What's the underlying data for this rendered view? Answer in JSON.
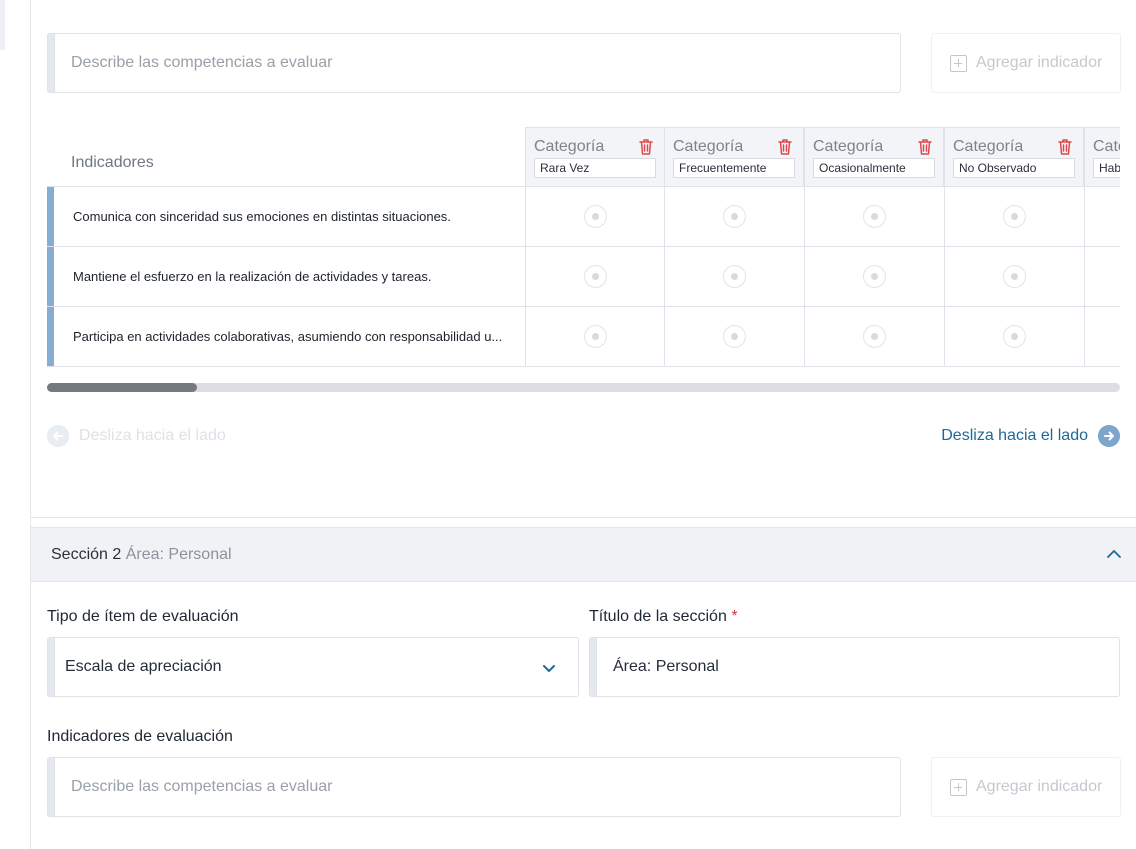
{
  "section1": {
    "indicator_input": {
      "placeholder": "Describe las competencias a evaluar"
    },
    "add_indicator_label": "Agregar indicador",
    "table": {
      "indicators_header": "Indicadores",
      "category_title": "Categoría",
      "categories": [
        "Rara Vez",
        "Frecuentemente",
        "Ocasionalmente",
        "No Observado",
        "Hab"
      ],
      "partial_category_title": "Cate",
      "rows": [
        "Comunica con sinceridad sus emociones en distintas situaciones.",
        "Mantiene el esfuerzo en la realización de actividades y tareas.",
        "Participa en actividades colaborativas, asumiendo con responsabilidad u..."
      ]
    },
    "scroll_progress_percent": 14,
    "swipe_left_label": "Desliza hacia el lado",
    "swipe_right_label": "Desliza hacia el lado"
  },
  "section2": {
    "header_title": "Sección 2",
    "header_subtitle": "Área: Personal",
    "item_type_label": "Tipo de ítem de evaluación",
    "item_type_value": "Escala de apreciación",
    "section_title_label": "Título de la sección",
    "required_mark": "*",
    "section_title_value": "Área: Personal",
    "indicators_label": "Indicadores de evaluación",
    "indicator_input": {
      "placeholder": "Describe las competencias a evaluar"
    },
    "add_indicator_label": "Agregar indicador"
  },
  "colors": {
    "accent": "#1e6a97",
    "row_marker": "#87aed0",
    "delete_icon": "#e0464e",
    "required": "#d9363e"
  }
}
